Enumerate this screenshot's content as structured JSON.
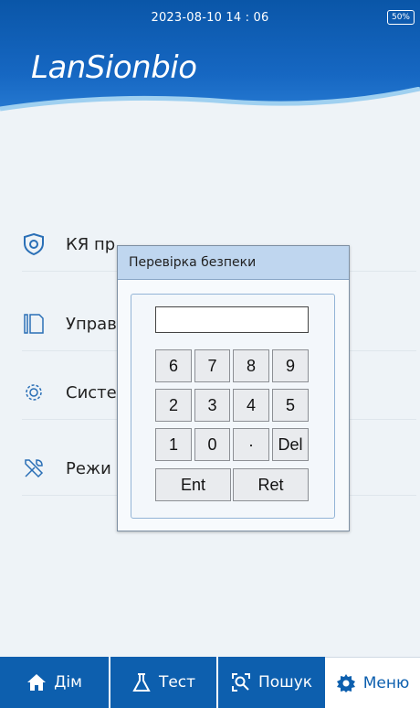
{
  "status_bar": {
    "datetime": "2023-08-10 14 : 06",
    "battery": "50%"
  },
  "header": {
    "logo_text": "LanSionbio"
  },
  "menu": {
    "items": [
      {
        "label": "КЯ пр",
        "icon": "shield-icon"
      },
      {
        "label": "Управ",
        "icon": "document-icon"
      },
      {
        "label": "Систе",
        "icon": "gear-icon"
      },
      {
        "label": "Режи",
        "icon": "tools-icon"
      }
    ]
  },
  "dialog": {
    "title": "Перевірка безпеки",
    "input_value": "",
    "keys": {
      "k6": "6",
      "k7": "7",
      "k8": "8",
      "k9": "9",
      "k2": "2",
      "k3": "3",
      "k4": "4",
      "k5": "5",
      "k1": "1",
      "k0": "0",
      "kdot": "·",
      "kdel": "Del",
      "kent": "Ent",
      "kret": "Ret"
    }
  },
  "nav": {
    "home": "Дім",
    "test": "Тест",
    "search": "Пошук",
    "menu": "Меню"
  },
  "colors": {
    "brand_blue": "#0d5fae",
    "dialog_title_bg": "#bfd6ef"
  }
}
